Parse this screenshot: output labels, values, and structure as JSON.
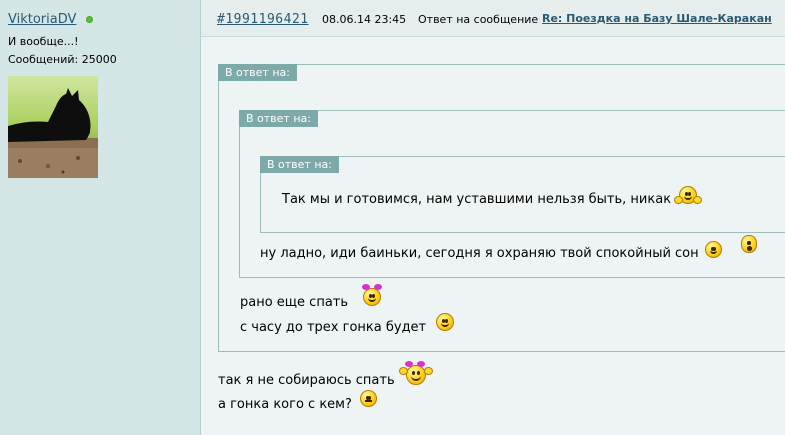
{
  "user": {
    "name": "ViktoriaDV",
    "status": "И вообще...!",
    "posts": "Сообщений: 25000"
  },
  "post": {
    "id_link": "#1991196421",
    "date": "08.06.14 23:45",
    "reply_to_label": "Ответ на сообщение",
    "reply_to_title": "Re: Поездка на Базу Шале-Каракан"
  },
  "quotes": {
    "label": "В ответ на:",
    "inner": "Так мы и готовимся, нам уставшими нельзя быть, никак",
    "middle": "ну ладно, иди баиньки, сегодня я охраняю твой спокойный сон",
    "outer": [
      "рано еще спать",
      "с часу до трех гонка будет"
    ]
  },
  "message": [
    "так я не собираюсь спать",
    "а гонка кого с кем?"
  ],
  "colors": {
    "link": "#2a5a73",
    "quote_label_bg": "#7ea9a9",
    "online": "#5fbe3c"
  }
}
